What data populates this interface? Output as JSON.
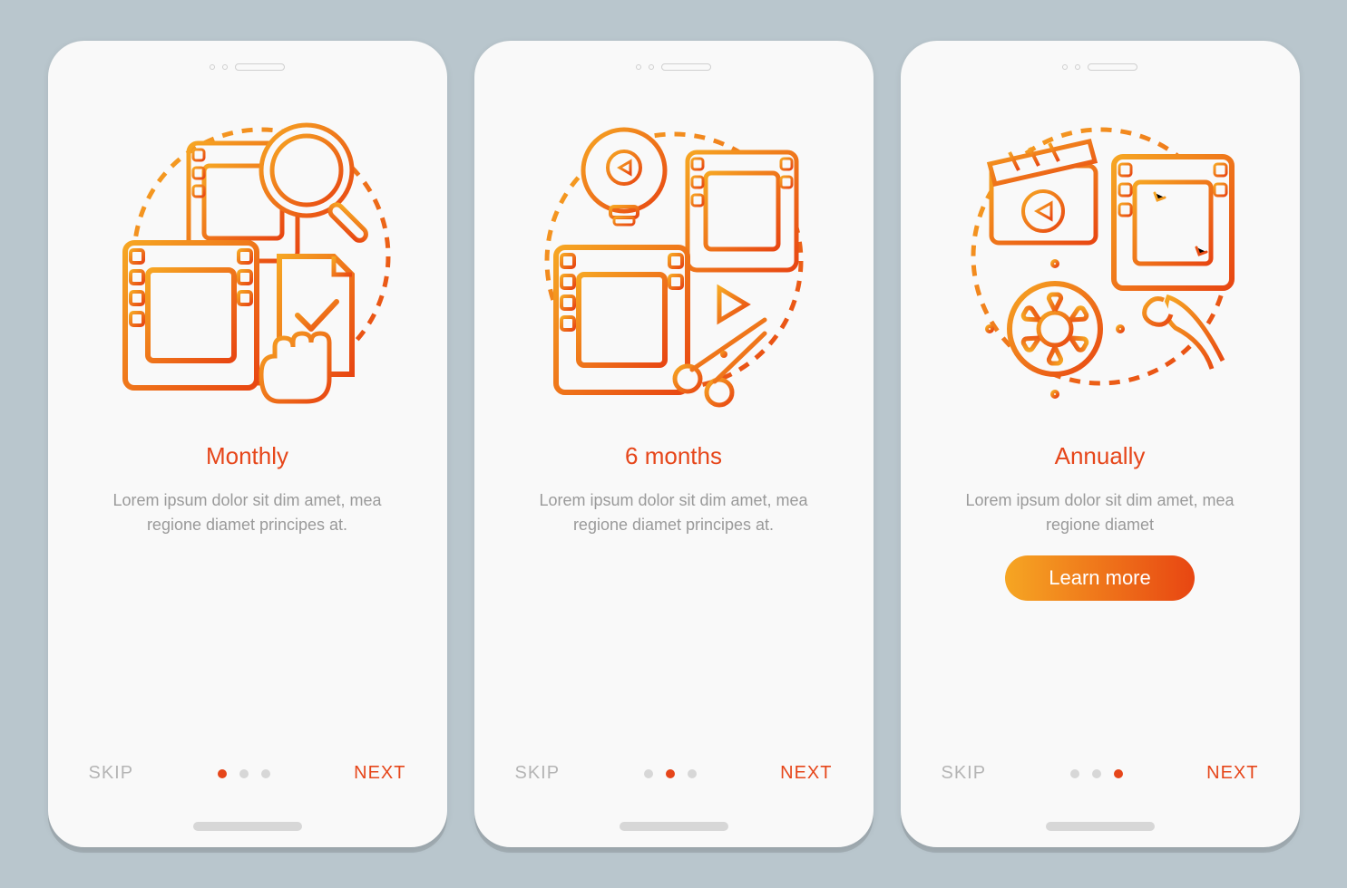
{
  "colors": {
    "accent": "#e6461a",
    "muted": "#9a9a9a",
    "gradient_start": "#f6a623",
    "gradient_end": "#e84612"
  },
  "screens": [
    {
      "icon": "film-search-check-icon",
      "title": "Monthly",
      "desc": "Lorem ipsum dolor sit dim amet, mea regione diamet principes at.",
      "skip": "SKIP",
      "next": "NEXT",
      "active_dot": 0,
      "has_cta": false
    },
    {
      "icon": "film-bulb-scissors-icon",
      "title": "6 months",
      "desc": "Lorem ipsum dolor sit dim amet, mea regione diamet principes at.",
      "skip": "SKIP",
      "next": "NEXT",
      "active_dot": 1,
      "has_cta": false
    },
    {
      "icon": "clapper-gear-brush-icon",
      "title": "Annually",
      "desc": "Lorem ipsum dolor sit dim amet, mea regione diamet",
      "skip": "SKIP",
      "next": "NEXT",
      "active_dot": 2,
      "has_cta": true,
      "cta": "Learn more"
    }
  ]
}
